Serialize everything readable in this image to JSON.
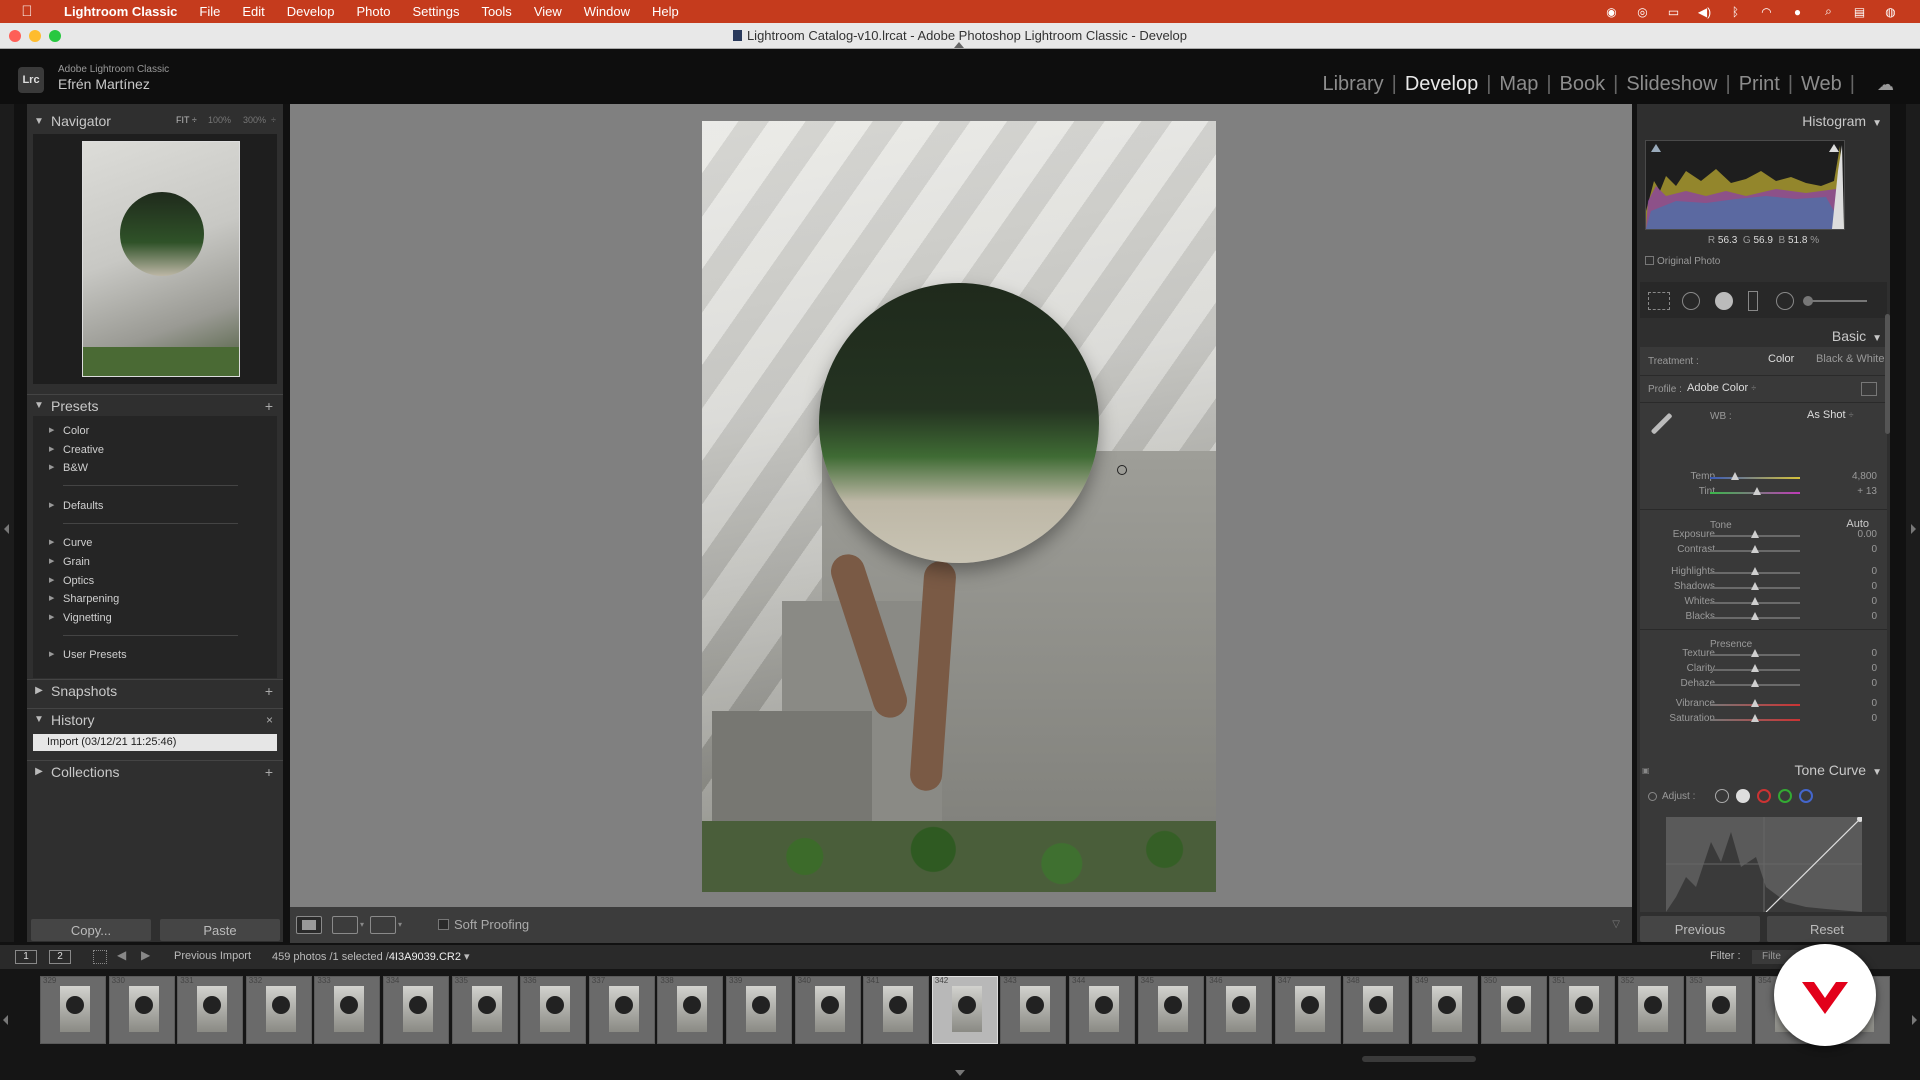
{
  "menubar": {
    "app": "Lightroom Classic",
    "items": [
      "File",
      "Edit",
      "Develop",
      "Photo",
      "Settings",
      "Tools",
      "View",
      "Window",
      "Help"
    ]
  },
  "window": {
    "title": "Lightroom Catalog-v10.lrcat - Adobe Photoshop Lightroom Classic - Develop"
  },
  "identity": {
    "product": "Adobe Lightroom Classic",
    "user": "Efrén Martínez",
    "badge": "Lrc"
  },
  "modules": {
    "items": [
      "Library",
      "Develop",
      "Map",
      "Book",
      "Slideshow",
      "Print",
      "Web"
    ],
    "active": "Develop",
    "sep": "|"
  },
  "navigator": {
    "title": "Navigator",
    "fit": "FIT ÷",
    "z100": "100%",
    "z300": "300%",
    "zmore": "÷"
  },
  "presets": {
    "title": "Presets",
    "groups": [
      "Color",
      "Creative",
      "B&W",
      "Defaults",
      "Curve",
      "Grain",
      "Optics",
      "Sharpening",
      "Vignetting",
      "User Presets"
    ]
  },
  "snapshots": {
    "title": "Snapshots"
  },
  "history": {
    "title": "History",
    "items": [
      "Import (03/12/21 11:25:46)"
    ]
  },
  "collections": {
    "title": "Collections"
  },
  "left_buttons": {
    "copy": "Copy...",
    "paste": "Paste"
  },
  "toolbar": {
    "soft_proofing": "Soft Proofing"
  },
  "right": {
    "histogram": "Histogram",
    "r_label": "R",
    "r_val": "56.3",
    "g_label": "G",
    "g_val": "56.9",
    "b_label": "B",
    "b_val": "51.8",
    "pct": "%",
    "original_photo": "Original Photo",
    "basic": "Basic",
    "treatment_label": "Treatment :",
    "treatment_color": "Color",
    "treatment_bw": "Black & White",
    "profile_label": "Profile :",
    "profile_value": "Adobe Color",
    "profile_arrow": "÷",
    "wb_label": "WB :",
    "wb_value": "As Shot",
    "wb_arrow": "÷",
    "tone": "Tone",
    "auto": "Auto",
    "presence": "Presence",
    "tone_curve": "Tone Curve",
    "adjust": "Adjust :",
    "previous": "Previous",
    "reset": "Reset",
    "sliders": [
      {
        "name": "Temp",
        "value": "4,800",
        "level": 0.28
      },
      {
        "name": "Tint",
        "value": "+ 13",
        "level": 0.52
      },
      {
        "name": "Exposure",
        "value": "0.00",
        "level": 0.5
      },
      {
        "name": "Contrast",
        "value": "0",
        "level": 0.5
      },
      {
        "name": "Highlights",
        "value": "0",
        "level": 0.5
      },
      {
        "name": "Shadows",
        "value": "0",
        "level": 0.5
      },
      {
        "name": "Whites",
        "value": "0",
        "level": 0.5
      },
      {
        "name": "Blacks",
        "value": "0",
        "level": 0.5
      },
      {
        "name": "Texture",
        "value": "0",
        "level": 0.5
      },
      {
        "name": "Clarity",
        "value": "0",
        "level": 0.5
      },
      {
        "name": "Dehaze",
        "value": "0",
        "level": 0.5
      },
      {
        "name": "Vibrance",
        "value": "0",
        "level": 0.5
      },
      {
        "name": "Saturation",
        "value": "0",
        "level": 0.5
      }
    ]
  },
  "filmstrip": {
    "page1": "1",
    "page2": "2",
    "source": "Previous Import",
    "count": "459 photos /1 selected /",
    "filename": "4I3A9039.CR2",
    "file_arrow": "▾",
    "filter": "Filter :",
    "filter_value": "Filte",
    "numbers": [
      "329",
      "330",
      "331",
      "332",
      "333",
      "334",
      "335",
      "336",
      "337",
      "338",
      "339",
      "340",
      "341",
      "342",
      "343",
      "344",
      "345",
      "346",
      "347",
      "348",
      "349",
      "350",
      "351",
      "352",
      "353",
      "354",
      "355"
    ],
    "selected_index": 13
  },
  "colors": {
    "menubar": "#c53b1d",
    "accent_red": "#e2001a"
  }
}
